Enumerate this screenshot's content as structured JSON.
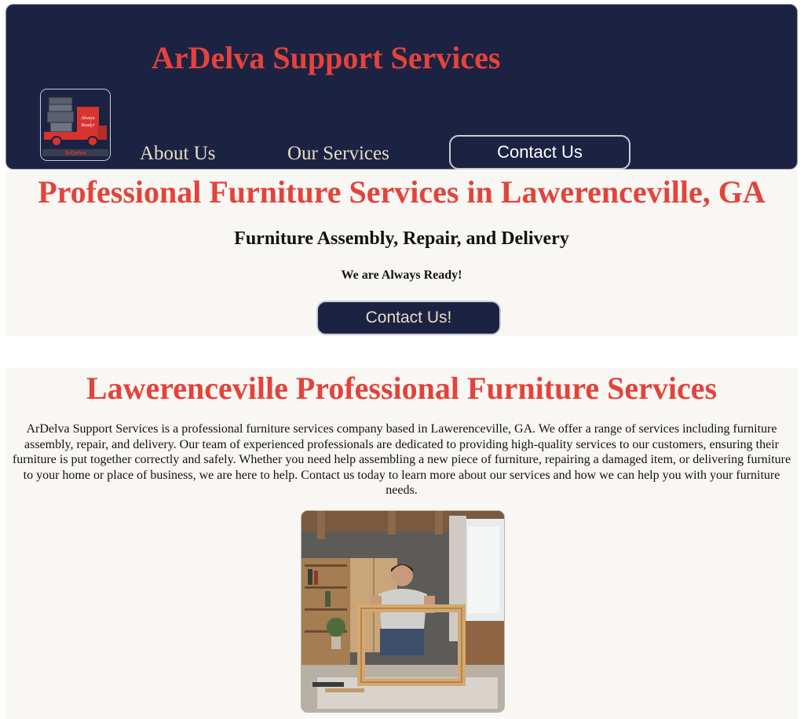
{
  "header": {
    "title": "ArDelva Support Services",
    "logo_text": "ArDelva Support Services",
    "logo_tagline": "Always Ready!",
    "nav": [
      "About Us",
      "Our Services",
      "Contact Us"
    ]
  },
  "hero": {
    "title": "Professional Furniture Services in Lawerenceville, GA",
    "subtitle": "Furniture Assembly, Repair, and Delivery",
    "tagline": "We are Always Ready!",
    "cta_label": "Contact Us!"
  },
  "about": {
    "title": "Lawerenceville Professional Furniture Services",
    "body": "ArDelva Support Services is a professional furniture services company based in Lawerenceville, GA. We offer a range of services including furniture assembly, repair, and delivery. Our team of experienced professionals are dedicated to providing high-quality services to our customers, ensuring their furniture is put together correctly and safely. Whether you need help assembling a new piece of furniture, repairing a damaged item, or delivering furniture to your home or place of business, we are here to help. Contact us today to learn more about our services and how we can help you with your furniture needs.",
    "image": "furniture-assembly-photo"
  },
  "colors": {
    "navy": "#1c2342",
    "accent_red": "#e4433b",
    "cream_text": "#e6dcc8",
    "section_bg": "#f9f7f3"
  }
}
